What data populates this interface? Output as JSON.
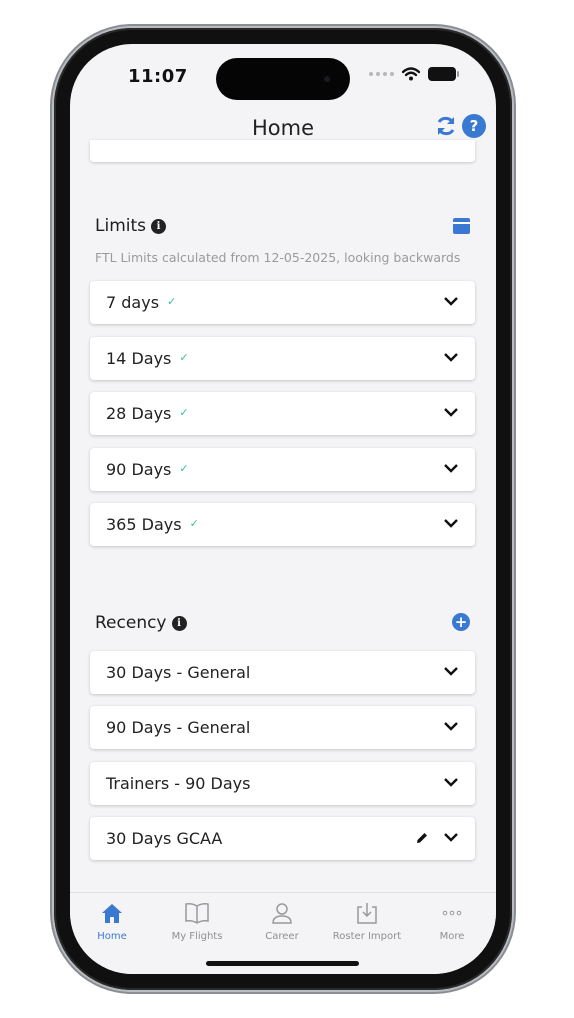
{
  "status_bar": {
    "time": "11:07"
  },
  "header": {
    "title": "Home"
  },
  "limits": {
    "title": "Limits",
    "subtitle": "FTL Limits calculated from 12-05-2025, looking backwards",
    "items": [
      {
        "label": "7 days"
      },
      {
        "label": "14 Days"
      },
      {
        "label": "28 Days"
      },
      {
        "label": "90 Days"
      },
      {
        "label": "365 Days"
      }
    ]
  },
  "recency": {
    "title": "Recency",
    "items": [
      {
        "label": "30 Days - General"
      },
      {
        "label": "90 Days - General"
      },
      {
        "label": "Trainers - 90 Days"
      },
      {
        "label": "30 Days GCAA"
      }
    ]
  },
  "tabbar": {
    "tabs": [
      {
        "label": "Home",
        "icon": "home-icon",
        "active": true
      },
      {
        "label": "My Flights",
        "icon": "book-icon"
      },
      {
        "label": "Career",
        "icon": "person-icon"
      },
      {
        "label": "Roster Import",
        "icon": "download-icon"
      },
      {
        "label": "More",
        "icon": "more-icon"
      }
    ]
  },
  "colors": {
    "accent": "#3a79d1",
    "check": "#3fbf8f",
    "background": "#f4f4f6"
  }
}
